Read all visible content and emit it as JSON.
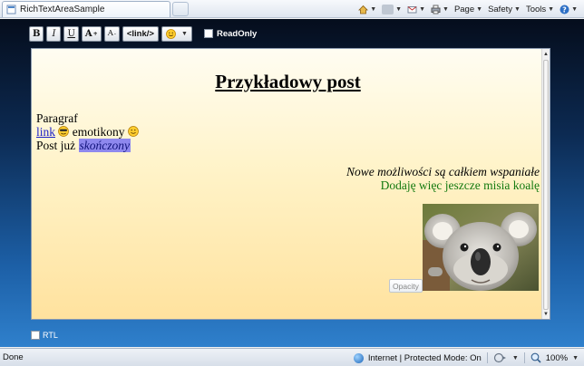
{
  "browser": {
    "tab_title": "RichTextAreaSample",
    "commands": {
      "page": "Page",
      "safety": "Safety",
      "tools": "Tools"
    }
  },
  "toolbar": {
    "bold": "B",
    "italic": "I",
    "underline": "U",
    "font_grow": "A",
    "font_shrink": "A",
    "link": "<link/>",
    "readonly_label": "ReadOnly"
  },
  "editor": {
    "title": "Przykładowy post",
    "paragraph": "Paragraf",
    "link_text": "link",
    "emoticons_text": "emotikony",
    "post_prefix": "Post już",
    "post_highlight": "skończony",
    "right_line1": "Nowe możliwości są całkiem wspaniałe",
    "right_line2": "Dodaję więc jeszcze misia koalę",
    "opacity_button": "Opacity"
  },
  "bottom": {
    "rtl_label": "RTL"
  },
  "status": {
    "done": "Done",
    "zone": "Internet | Protected Mode: On",
    "zoom": "100%"
  },
  "colors": {
    "link": "#1a20c8",
    "highlight": "#8e88ee",
    "green_text": "#147a10"
  }
}
